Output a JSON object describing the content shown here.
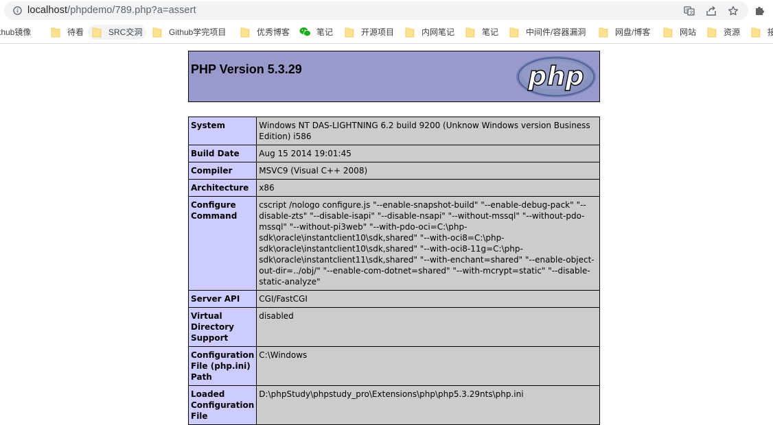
{
  "browser": {
    "url_host": "localhost",
    "url_path": "/phpdemo/789.php?a=assert",
    "bookmarks": [
      {
        "label": "thub镜像",
        "icon": "none"
      },
      {
        "label": "待看",
        "icon": "folder-icon"
      },
      {
        "label": "SRC交洞",
        "icon": "folder-icon"
      },
      {
        "label": "Github学完项目",
        "icon": "folder-icon"
      },
      {
        "label": "优秀博客",
        "icon": "folder-icon"
      },
      {
        "label": "笔记",
        "icon": "wechat-icon"
      },
      {
        "label": "开源项目",
        "icon": "folder-icon"
      },
      {
        "label": "内网笔记",
        "icon": "folder-icon"
      },
      {
        "label": "笔记",
        "icon": "folder-icon"
      },
      {
        "label": "中间件/容器漏洞",
        "icon": "folder-icon"
      },
      {
        "label": "网盘/博客",
        "icon": "folder-icon"
      },
      {
        "label": "网站",
        "icon": "folder-icon"
      },
      {
        "label": "资源",
        "icon": "folder-icon"
      },
      {
        "label": "接",
        "icon": "folder-icon"
      }
    ]
  },
  "phpinfo": {
    "title": "PHP Version 5.3.29",
    "logo_text": "php",
    "rows": [
      {
        "key": "System",
        "value": "Windows NT DAS-LIGHTNING 6.2 build 9200 (Unknow Windows version Business Edition) i586"
      },
      {
        "key": "Build Date",
        "value": "Aug 15 2014 19:01:45"
      },
      {
        "key": "Compiler",
        "value": "MSVC9 (Visual C++ 2008)"
      },
      {
        "key": "Architecture",
        "value": "x86"
      },
      {
        "key": "Configure Command",
        "value": "cscript /nologo configure.js \"--enable-snapshot-build\" \"--enable-debug-pack\" \"--disable-zts\" \"--disable-isapi\" \"--disable-nsapi\" \"--without-mssql\" \"--without-pdo-mssql\" \"--without-pi3web\" \"--with-pdo-oci=C:\\php-sdk\\oracle\\instantclient10\\sdk,shared\" \"--with-oci8=C:\\php-sdk\\oracle\\instantclient10\\sdk,shared\" \"--with-oci8-11g=C:\\php-sdk\\oracle\\instantclient11\\sdk,shared\" \"--with-enchant=shared\" \"--enable-object-out-dir=../obj/\" \"--enable-com-dotnet=shared\" \"--with-mcrypt=static\" \"--disable-static-analyze\""
      },
      {
        "key": "Server API",
        "value": "CGI/FastCGI"
      },
      {
        "key": "Virtual Directory Support",
        "value": "disabled"
      },
      {
        "key": "Configuration File (php.ini) Path",
        "value": "C:\\Windows"
      },
      {
        "key": "Loaded Configuration File",
        "value": "D:\\phpStudy\\phpstudy_pro\\Extensions\\php\\php5.3.29nts\\php.ini"
      }
    ]
  }
}
